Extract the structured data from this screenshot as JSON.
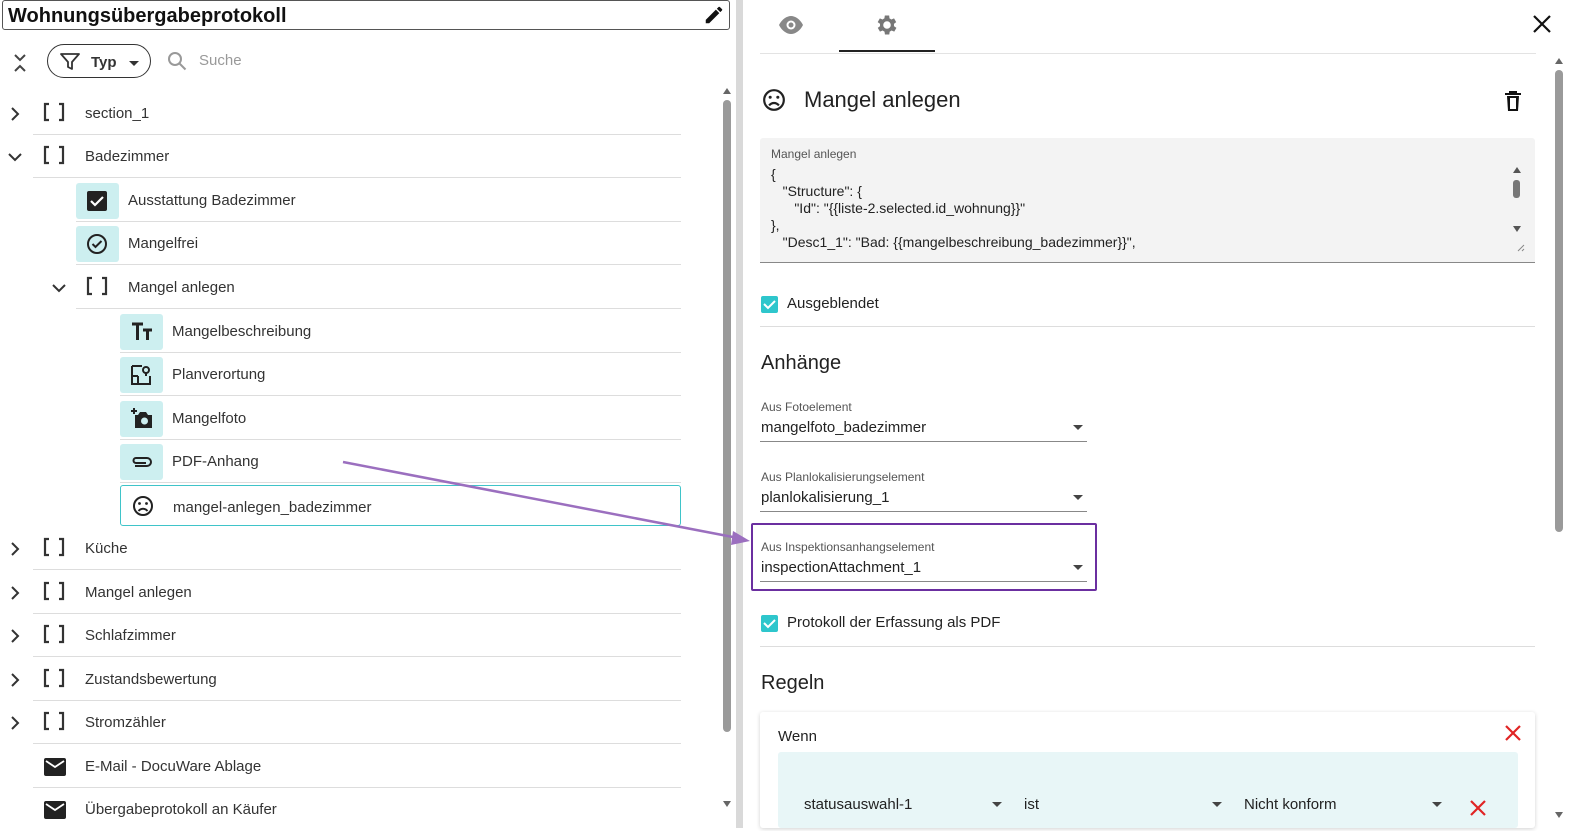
{
  "left": {
    "title": "Wohnungsübergabeprotokoll",
    "filter_label": "Typ",
    "search_placeholder": "Suche",
    "tree": [
      {
        "label": "section_1"
      },
      {
        "label": "Badezimmer"
      },
      {
        "label": "Ausstattung Badezimmer"
      },
      {
        "label": "Mangelfrei"
      },
      {
        "label": "Mangel anlegen"
      },
      {
        "label": "Mangelbeschreibung"
      },
      {
        "label": "Planverortung"
      },
      {
        "label": "Mangelfoto"
      },
      {
        "label": "PDF-Anhang"
      },
      {
        "label": "mangel-anlegen_badezimmer"
      },
      {
        "label": "Küche"
      },
      {
        "label": "Mangel anlegen"
      },
      {
        "label": "Schlafzimmer"
      },
      {
        "label": "Zustandsbewertung"
      },
      {
        "label": "Stromzähler"
      },
      {
        "label": "E-Mail - DocuWare Ablage"
      },
      {
        "label": "Übergabeprotokoll an Käufer"
      }
    ]
  },
  "right": {
    "heading": "Mangel anlegen",
    "code": {
      "caption": "Mangel anlegen",
      "lines": [
        "{",
        "   \"Structure\": {",
        "      \"Id\": \"{{liste-2.selected.id_wohnung}}\"",
        "},",
        "   \"Desc1_1\": \"Bad: {{mangelbeschreibung_badezimmer}}\","
      ]
    },
    "hidden_label": "Ausgeblendet",
    "attachments_title": "Anhänge",
    "selects": [
      {
        "caption": "Aus Fotoelement",
        "value": "mangelfoto_badezimmer"
      },
      {
        "caption": "Aus Planlokalisierungselement",
        "value": "planlokalisierung_1"
      },
      {
        "caption": "Aus Inspektionsanhangselement",
        "value": "inspectionAttachment_1"
      }
    ],
    "protocol_label": "Protokoll der Erfassung als PDF",
    "rules_title": "Regeln",
    "rule": {
      "when_label": "Wenn",
      "field": "statusauswahl-1",
      "operator": "ist",
      "value": "Nicht konform"
    }
  },
  "colors": {
    "accent": "#2ec6cc",
    "tile_bg": "#cdeff0",
    "highlight": "#6b2fa0",
    "arrow": "#9b6fbf",
    "delete": "#e02424"
  }
}
